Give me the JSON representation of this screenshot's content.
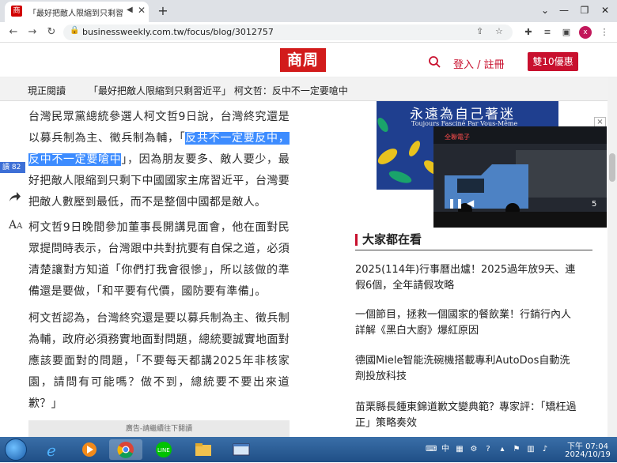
{
  "browser": {
    "tab_title": "「最好把敵人限縮到只剩習近",
    "url": "businessweekly.com.tw/focus/blog/3012757",
    "profile_initial": "x"
  },
  "site": {
    "logo_text": "商周",
    "login_label": "登入 / 註冊",
    "promo_label": "雙10優惠"
  },
  "reading_bar": {
    "label": "現正閱讀",
    "title": "「最好把敵人限縮到只剩習近平」 柯文哲：反中不一定要嗆中"
  },
  "article": {
    "p1_before": "台灣民眾黨總統參選人柯文哲9日說，台灣終究還是以募兵制為主、徵兵制為輔，「",
    "p1_highlight": "反共不一定要反中，反中不一定要嗆中",
    "p1_after": "」，因為朋友要多、敵人要少，最好把敵人限縮到只剩下中國國家主席習近平，台灣要把敵人數壓到最低，而不是整個中國都是敵人。",
    "p2": "柯文哲9日晚間參加董事長開講見面會，他在面對民眾提問時表示，台灣跟中共對抗要有自保之道，必須清楚讓對方知道「你們打我會很慘」，所以該做的準備還是要做，「和平要有代價，國防要有準備」。",
    "p3": "柯文哲認為，台灣終究還是要以募兵制為主、徵兵制為輔，政府必須務實地面對問題，總統要誠實地面對應該要面對的問題，「不要每天都講2025年非核家園，請問有可能嗎？做不到，總統要不要出來道歉？」",
    "ad_notice": "廣告-請繼續往下閱讀",
    "side_tag": "讀 82"
  },
  "sidebar": {
    "ad_title": "永遠為自己著迷",
    "ad_subtitle": "Toujours Fasciné Par Vous-Même",
    "video_brand": "全聯電子",
    "video_counter": "5",
    "video_close": "×",
    "popular_heading": "大家都在看",
    "popular_items": [
      "2025(114年)行事曆出爐！2025過年放9天、連假6個，全年請假攻略",
      "一個節目，拯救一個國家的餐飲業！行銷行內人詳解《黑白大廚》爆紅原因",
      "德國Miele智能洗碗機搭載專利AutoDos自動洗劑投放科技",
      "苗栗縣長鍾東錦道歉文變典範？專家評：「矯枉過正」策略奏效"
    ]
  },
  "taskbar": {
    "time": "下午 07:04",
    "date": "2024/10/19"
  }
}
